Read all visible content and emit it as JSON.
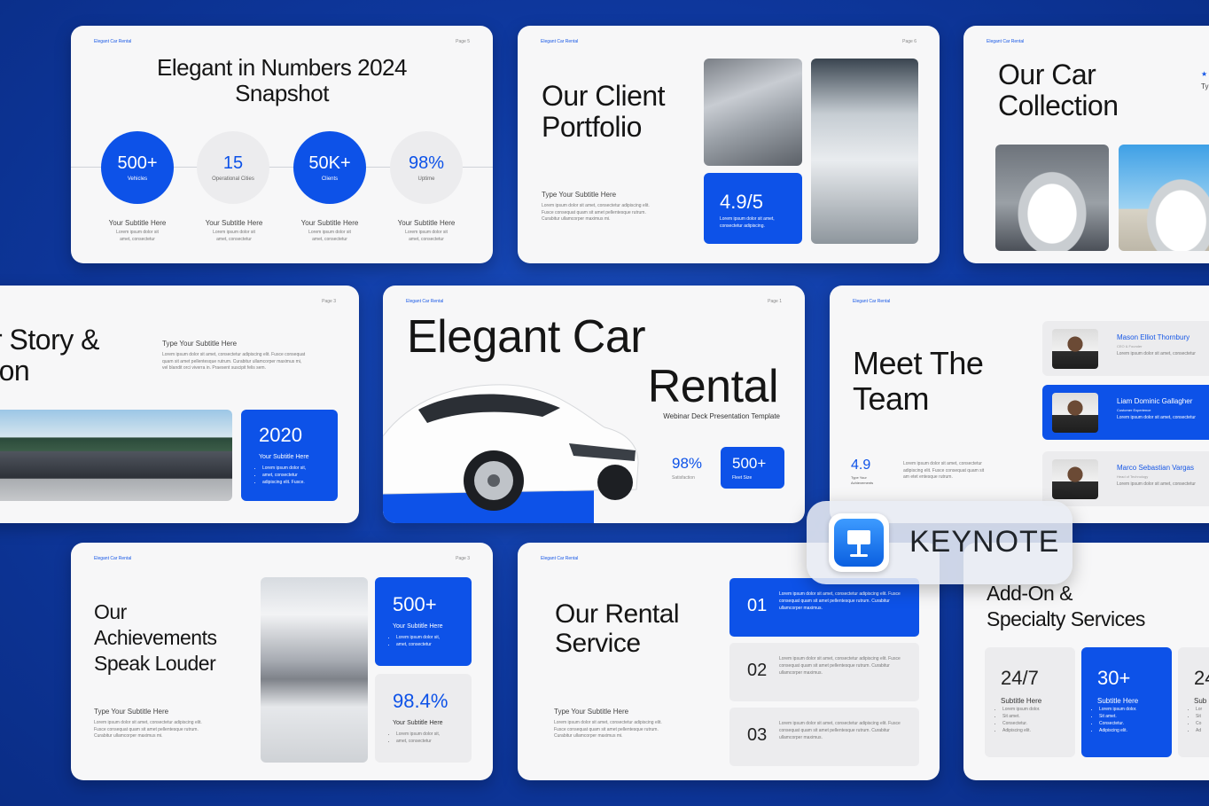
{
  "brand": "Elegant Car Rental",
  "numbers": {
    "page": "Page 5",
    "title_line1": "Elegant in Numbers 2024",
    "title_line2": "Snapshot",
    "stats": [
      {
        "value": "500+",
        "label": "Vehicles"
      },
      {
        "value": "15",
        "label": "Operational Cities"
      },
      {
        "value": "50K+",
        "label": "Clients"
      },
      {
        "value": "98%",
        "label": "Uptime"
      }
    ],
    "col_subtitle": "Your Subtitle Here",
    "col_text_1": "Lorem ipsum dolor sit",
    "col_text_2": "amet, consectetur"
  },
  "portfolio": {
    "page": "Page 6",
    "title_line1": "Our Client",
    "title_line2": "Portfolio",
    "subtitle": "Type Your Subtitle Here",
    "text_1": "Lorem ipsum dolor sit amet, consectetur adipiscing elit.",
    "text_2": "Fusce consequat quam sit amet pellentesque rutrum.",
    "text_3": "Curabitur ullamcorper maximus mi.",
    "rating": "4.9/5",
    "rating_text_1": "Lorem ipsum dolor sit amet,",
    "rating_text_2": "consectetur adipiscing."
  },
  "collection": {
    "title_line1": "Our Car",
    "title_line2": "Collection",
    "edge_text": "Ty"
  },
  "story": {
    "page": "Page 3",
    "title_line1": "r Story &",
    "title_line2": "ion",
    "subtitle": "Type Your Subtitle Here",
    "text_1": "Lorem ipsum dolor sit amet, consectetur adipiscing elit. Fusce consequat",
    "text_2": "quam sit amet pellentesque rutrum. Curabitur ullamcorper maximus mi,",
    "text_3": "vel blandit orci viverra in. Praesent suscipit felis sem.",
    "year": "2020",
    "year_sub": "Your Subtitle Here",
    "bullets": [
      "Lorem ipsum dolor sit,",
      "amet, consectetur",
      "adipiscing elit. Fusce."
    ]
  },
  "cover": {
    "page": "Page 1",
    "title_line1": "Elegant Car",
    "title_line2": "Rental",
    "tagline": "Webinar Deck Presentation Template",
    "stat1_value": "98%",
    "stat1_label": "Satisfaction",
    "stat2_value": "500+",
    "stat2_label": "Fleet Size"
  },
  "team": {
    "title_line1": "Meet The",
    "title_line2": "Team",
    "rating": "4.9",
    "rating_label_1": "Type Your",
    "rating_label_2": "Achievements",
    "text_1": "Lorem ipsum dolor sit amet, consectetur",
    "text_2": "adipiscing elit. Fusce consequat quam sit",
    "text_3": "am etet entesque rutrum.",
    "members": [
      {
        "name": "Mason Elliot Thornbury",
        "role": "CEO & Founder",
        "desc": "Lorem ipsum dolor sit amet, consectetur"
      },
      {
        "name": "Liam Dominic Gallagher",
        "role": "Customer Experience",
        "desc": "Lorem ipsum dolor sit amet, consectetur"
      },
      {
        "name": "Marco Sebastian Vargas",
        "role": "Head of Technology",
        "desc": "Lorem ipsum dolor sit amet, consectetur"
      }
    ]
  },
  "keynote_badge": "KEYNOTE",
  "achievements": {
    "page": "Page 3",
    "title_line1": "Our",
    "title_line2": "Achievements",
    "title_line3": "Speak Louder",
    "subtitle": "Type Your Subtitle Here",
    "text_1": "Lorem ipsum dolor sit amet, consectetur adipiscing elit.",
    "text_2": "Fusce consequat quam sit amet pellentesque rutrum.",
    "text_3": "Curabitur ullamcorper maximus mi.",
    "stat1_value": "500+",
    "stat1_sub": "Your Subtitle Here",
    "stat1_bullets": [
      "Lorem ipsum dolor sit,",
      "amet, consectetur"
    ],
    "stat2_value": "98.4%",
    "stat2_sub": "Your Subtitle Here",
    "stat2_bullets": [
      "Lorem ipsum dolor sit,",
      "amet, consectetur"
    ]
  },
  "rental": {
    "title_line1": "Our Rental",
    "title_line2": "Service",
    "subtitle": "Type Your Subtitle Here",
    "text_1": "Lorem ipsum dolor sit amet, consectetur adipiscing elit.",
    "text_2": "Fusce consequat quam sit amet pellentesque rutrum.",
    "text_3": "Curabitur ullamcorper maximus mi.",
    "items": [
      {
        "num": "01",
        "text": "Lorem ipsum dolor sit amet, consectetur adipiscing elit. Fusce consequat quam sit amet pellentesque rutrum. Curabitur ullamcorper maximus."
      },
      {
        "num": "02",
        "text": "Lorem ipsum dolor sit amet, consectetur adipiscing elit. Fusce consequat quam sit amet pellentesque rutrum. Curabitur ullamcorper maximus."
      },
      {
        "num": "03",
        "text": "Lorem ipsum dolor sit amet, consectetur adipiscing elit. Fusce consequat quam sit amet pellentesque rutrum. Curabitur ullamcorper maximus."
      }
    ]
  },
  "addon": {
    "title_line1": "Add-On &",
    "title_line2": "Specialty Services",
    "stats": [
      {
        "value": "24/7",
        "sub": "Subtitle Here",
        "bullets": [
          "Lorem ipsum dolor.",
          "Sit amet.",
          "Consectetur.",
          "Adipiscing elit."
        ]
      },
      {
        "value": "30+",
        "sub": "Subtitle Here",
        "bullets": [
          "Lorem ipsum dolor.",
          "Sit amet.",
          "Consectetur.",
          "Adipiscing elit."
        ]
      },
      {
        "value": "24",
        "sub": "Sub",
        "bullets": [
          "Lor",
          "Sit",
          "Co",
          "Ad"
        ]
      }
    ]
  },
  "colors": {
    "accent": "#0d52e8",
    "background": "#0f3aa3",
    "slide": "#f7f7f8"
  }
}
